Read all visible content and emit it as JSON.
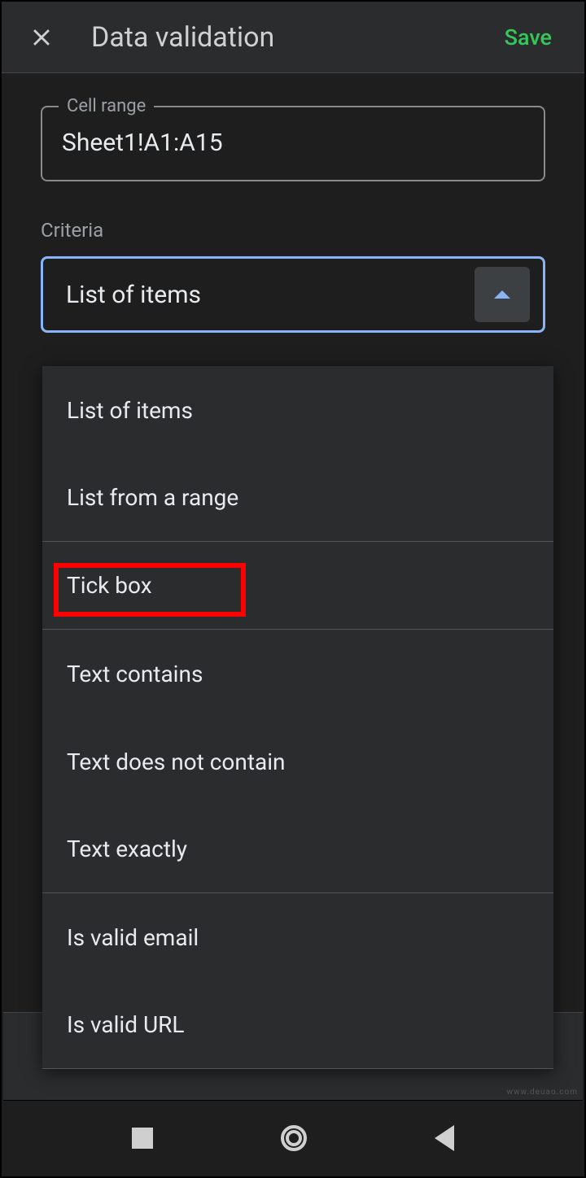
{
  "header": {
    "title": "Data validation",
    "save_label": "Save"
  },
  "cell_range": {
    "label": "Cell range",
    "value": "Sheet1!A1:A15"
  },
  "criteria": {
    "label": "Criteria",
    "selected": "List of items",
    "options": [
      "List of items",
      "List from a range",
      "Tick box",
      "Text contains",
      "Text does not contain",
      "Text exactly",
      "Is valid email",
      "Is valid URL"
    ]
  },
  "highlight_index": 2,
  "watermark": "www.deuao.com"
}
